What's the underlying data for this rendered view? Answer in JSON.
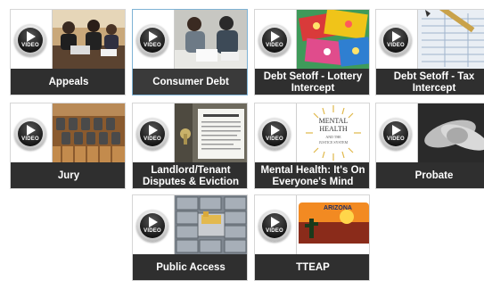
{
  "tiles": [
    {
      "title": "Appeals",
      "thumb_icon": "people-at-desk-image"
    },
    {
      "title": "Consumer Debt",
      "thumb_icon": "stressed-couple-image",
      "selected": true
    },
    {
      "title": "Debt Setoff - Lottery\nIntercept",
      "thumb_icon": "lottery-tickets-image"
    },
    {
      "title": "Debt Setoff - Tax\nIntercept",
      "thumb_icon": "tax-form-image"
    },
    {
      "title": "Jury",
      "thumb_icon": "jury-box-image"
    },
    {
      "title": "Landlord/Tenant\nDisputes & Eviction",
      "thumb_icon": "eviction-notice-door-image"
    },
    {
      "title": "Mental Health: It's On\nEveryone's Mind",
      "thumb_icon": "mental-health-seal-image",
      "thumb_text": [
        "MENTAL",
        "HEALTH",
        "AND THE",
        "JUSTICE SYSTEM"
      ]
    },
    {
      "title": "Probate",
      "thumb_icon": "holding-hands-image"
    },
    {
      "title": "Public Access",
      "thumb_icon": "file-cabinets-image"
    },
    {
      "title": "TTEAP",
      "thumb_icon": "arizona-license-plate-image",
      "thumb_text": [
        "ARIZONA"
      ]
    }
  ],
  "video_badge": "VIDEO",
  "colors": {
    "caption_bg": "#2f2f2f",
    "selected_border": "#7fb3d5"
  }
}
